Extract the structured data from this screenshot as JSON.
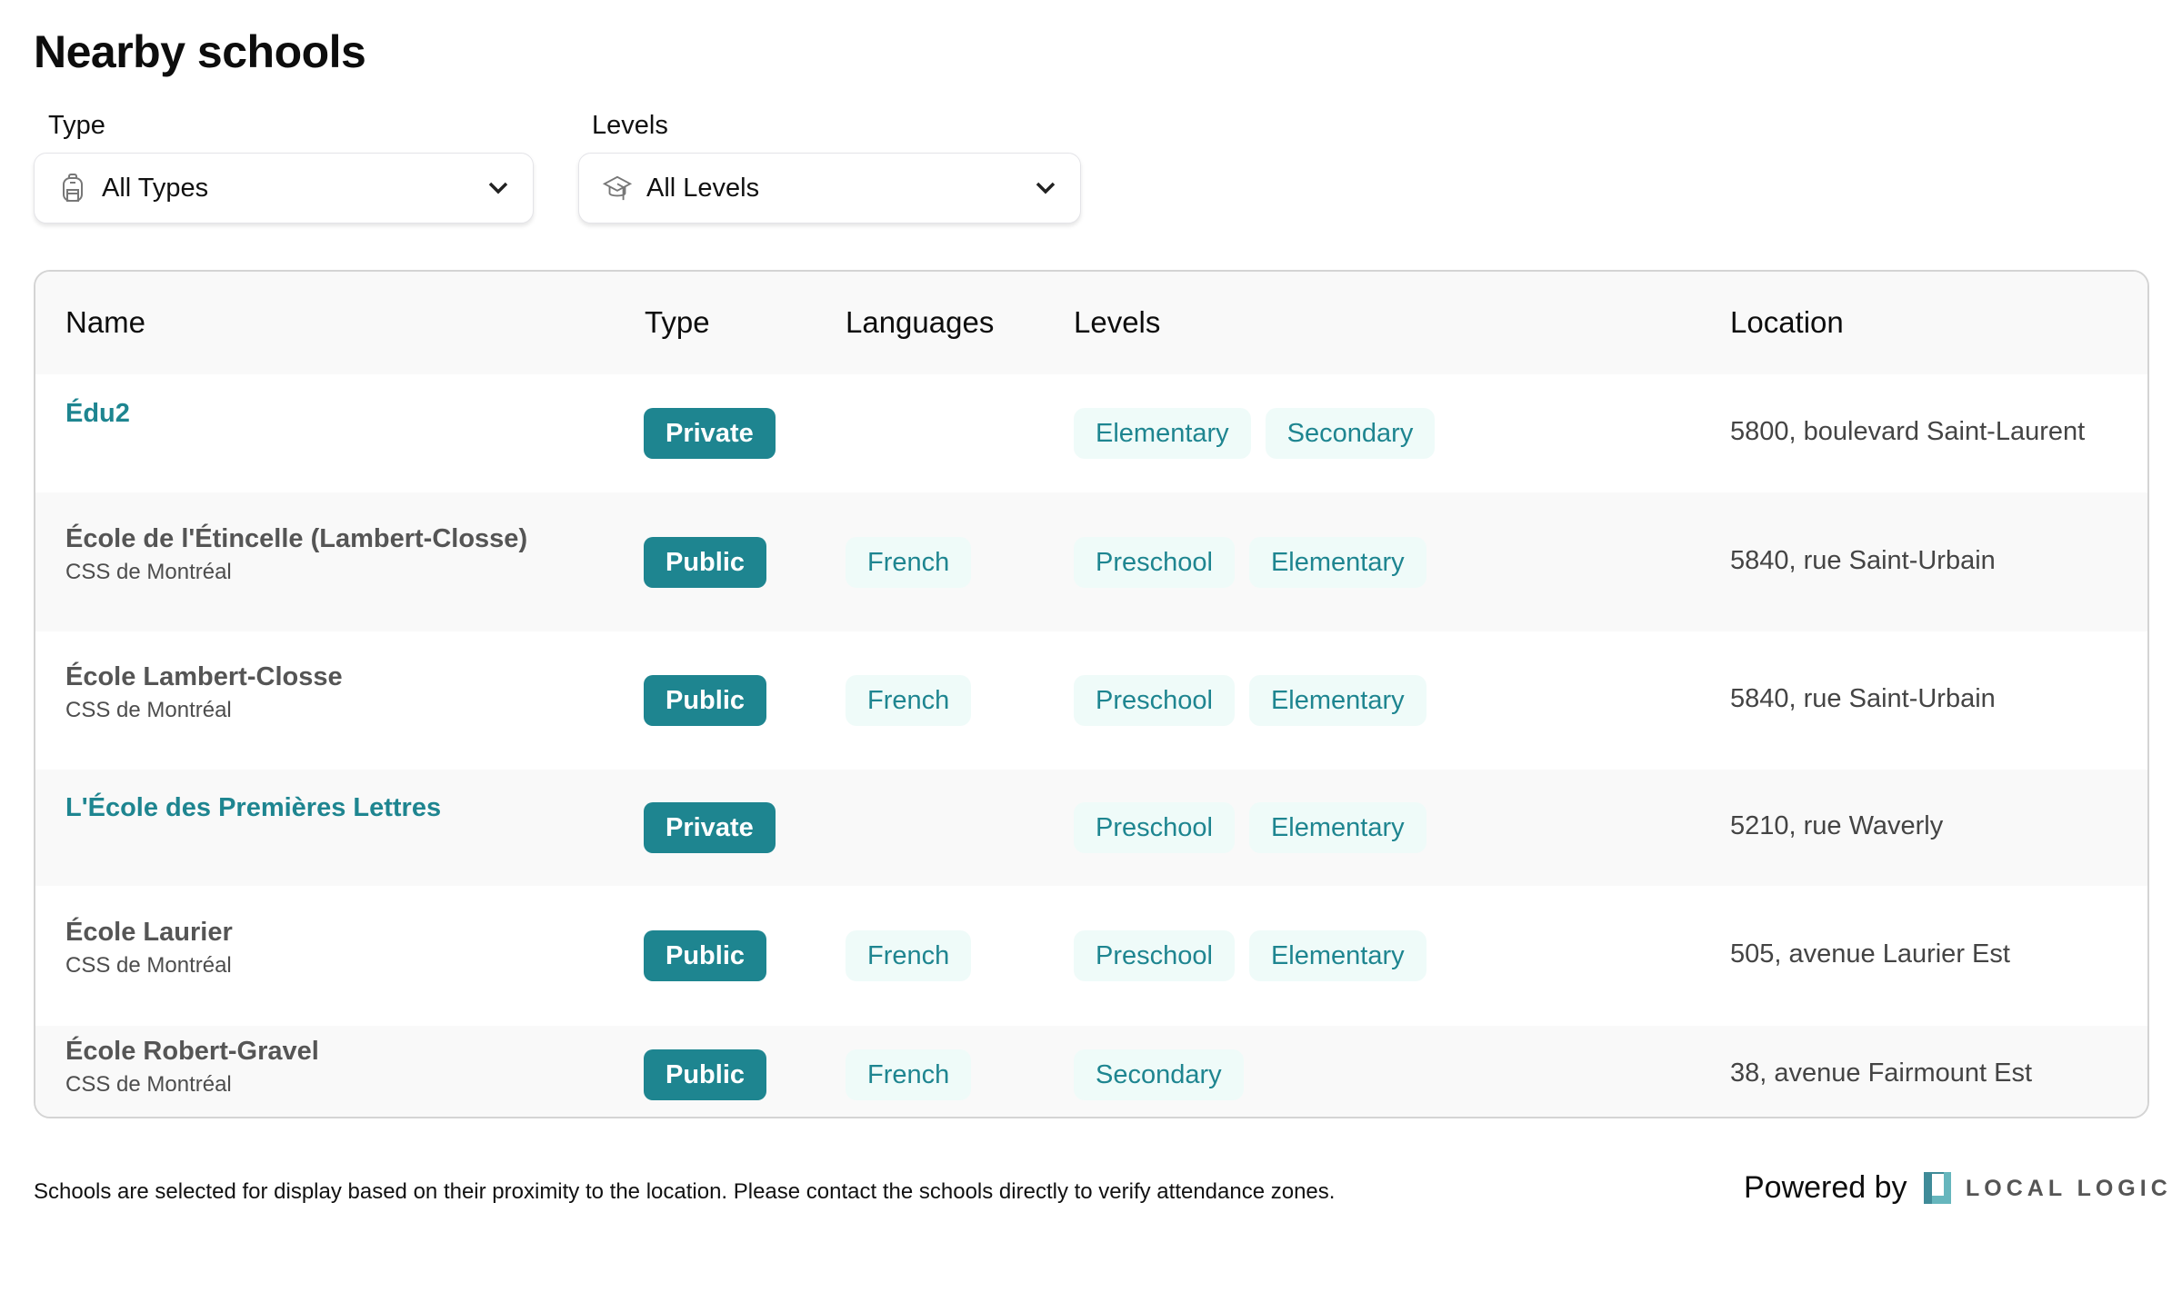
{
  "page": {
    "title": "Nearby schools"
  },
  "filters": {
    "type": {
      "label": "Type",
      "value": "All Types",
      "icon": "backpack-icon"
    },
    "levels": {
      "label": "Levels",
      "value": "All Levels",
      "icon": "graduation-cap-icon"
    }
  },
  "table": {
    "headers": {
      "name": "Name",
      "type": "Type",
      "languages": "Languages",
      "levels": "Levels",
      "location": "Location"
    },
    "rows": [
      {
        "name": "Édu2",
        "board": "",
        "link": true,
        "type": "Private",
        "languages": [],
        "levels": [
          "Elementary",
          "Secondary"
        ],
        "location": "5800, boulevard Saint-Laurent"
      },
      {
        "name": "École de l'Étincelle (Lambert-Closse)",
        "board": "CSS de Montréal",
        "link": false,
        "type": "Public",
        "languages": [
          "French"
        ],
        "levels": [
          "Preschool",
          "Elementary"
        ],
        "location": "5840, rue Saint-Urbain"
      },
      {
        "name": "École Lambert-Closse",
        "board": "CSS de Montréal",
        "link": false,
        "type": "Public",
        "languages": [
          "French"
        ],
        "levels": [
          "Preschool",
          "Elementary"
        ],
        "location": "5840, rue Saint-Urbain"
      },
      {
        "name": "L'École des Premières Lettres",
        "board": "",
        "link": true,
        "type": "Private",
        "languages": [],
        "levels": [
          "Preschool",
          "Elementary"
        ],
        "location": "5210, rue Waverly"
      },
      {
        "name": "École Laurier",
        "board": "CSS de Montréal",
        "link": false,
        "type": "Public",
        "languages": [
          "French"
        ],
        "levels": [
          "Preschool",
          "Elementary"
        ],
        "location": "505, avenue Laurier Est"
      },
      {
        "name": "École Robert-Gravel",
        "board": "CSS de Montréal",
        "link": false,
        "type": "Public",
        "languages": [
          "French"
        ],
        "levels": [
          "Secondary"
        ],
        "location": "38, avenue Fairmount Est"
      }
    ]
  },
  "footer": {
    "note": "Schools are selected for display based on their proximity to the location. Please contact the schools directly to verify attendance zones.",
    "powered_by": "Powered by",
    "brand": "LOCAL LOGIC"
  },
  "colors": {
    "accent": "#1e8590",
    "chip_bg": "#effbf9",
    "row_alt": "#f9f9f9"
  }
}
